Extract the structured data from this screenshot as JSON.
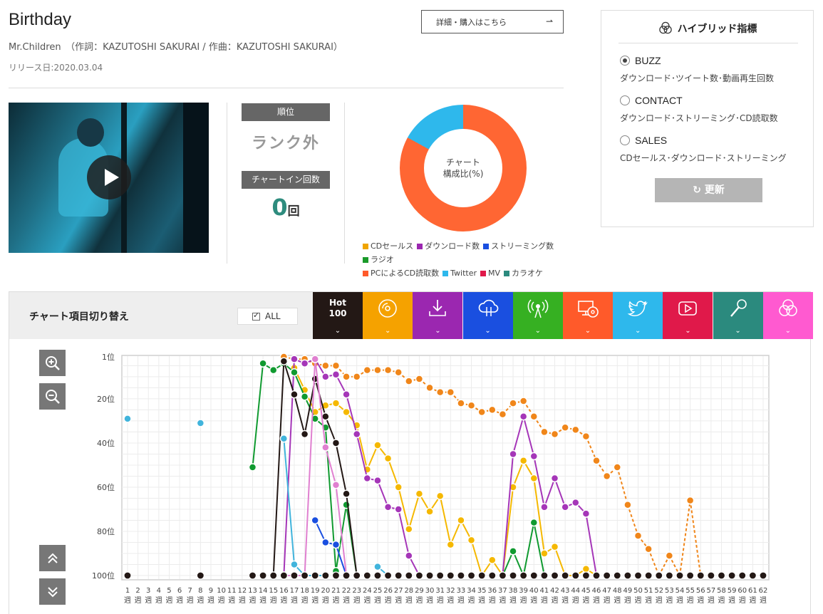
{
  "song": {
    "title": "Birthday",
    "credits": "Mr.Children　（作詞：KAZUTOSHI SAKURAI / 作曲：KAZUTOSHI SAKURAI）",
    "release": "リリース日:2020.03.04",
    "detail_button": "詳細・購入はこちら"
  },
  "rank": {
    "label": "順位",
    "value": "ランク外",
    "chartin_label": "チャートイン回数",
    "chartin_value": "0",
    "chartin_unit": "回"
  },
  "donut": {
    "center_line1": "チャート",
    "center_line2": "構成比(%)",
    "slices": [
      {
        "name": "PCによるCD読取数",
        "value": 83,
        "color": "#ff6633"
      },
      {
        "name": "Twitter",
        "value": 17,
        "color": "#2eb8ec"
      }
    ],
    "legend": [
      {
        "label": "CDセールス",
        "color": "#f0a500"
      },
      {
        "label": "ダウンロード数",
        "color": "#9b27b0"
      },
      {
        "label": "ストリーミング数",
        "color": "#1a4fe0"
      },
      {
        "label": "ラジオ",
        "color": "#1a9a2a"
      },
      {
        "label": "PCによるCD読取数",
        "color": "#ff5a2a"
      },
      {
        "label": "Twitter",
        "color": "#2eb8ec"
      },
      {
        "label": "MV",
        "color": "#e0194a"
      },
      {
        "label": "カラオケ",
        "color": "#2b8a7e"
      }
    ]
  },
  "hybrid": {
    "title": "ハイブリッド指標",
    "options": [
      {
        "name": "BUZZ",
        "desc": "ダウンロード･ツイート数･動画再生回数",
        "selected": true
      },
      {
        "name": "CONTACT",
        "desc": "ダウンロード･ストリーミング･CD読取数",
        "selected": false
      },
      {
        "name": "SALES",
        "desc": "CDセールス･ダウンロード･ストリーミング",
        "selected": false
      }
    ],
    "update_button": "更新"
  },
  "chart_section": {
    "label": "チャート項目切り替え",
    "all_label": "ALL",
    "tabs": [
      {
        "name": "hot100",
        "label_line1": "Hot",
        "label_line2": "100",
        "color": "#231815",
        "icon": "hot100"
      },
      {
        "name": "cd-sales",
        "color": "#f5a200",
        "icon": "cd-icon"
      },
      {
        "name": "download",
        "color": "#9b27b0",
        "icon": "download-icon"
      },
      {
        "name": "streaming",
        "color": "#1a4fe0",
        "icon": "streaming-icon"
      },
      {
        "name": "radio",
        "color": "#36b022",
        "icon": "radio-icon"
      },
      {
        "name": "pc-cd-read",
        "color": "#ff5a2a",
        "icon": "pc-cd-icon"
      },
      {
        "name": "twitter",
        "color": "#2eb8ec",
        "icon": "twitter-icon"
      },
      {
        "name": "mv",
        "color": "#e0194a",
        "icon": "youtube-icon"
      },
      {
        "name": "karaoke",
        "color": "#2b8a7e",
        "icon": "microphone-icon"
      },
      {
        "name": "hybrid",
        "color": "#ff5ad0",
        "icon": "hybrid-icon"
      }
    ]
  },
  "chart_data": {
    "type": "line",
    "y_inverted": true,
    "ylim": [
      1,
      100
    ],
    "y_tick_labels": [
      "1位",
      "20位",
      "40位",
      "60位",
      "80位",
      "100位"
    ],
    "y_ticks": [
      1,
      20,
      40,
      60,
      80,
      100
    ],
    "x": [
      1,
      2,
      3,
      4,
      5,
      6,
      7,
      8,
      9,
      10,
      11,
      12,
      13,
      14,
      15,
      16,
      17,
      18,
      19,
      20,
      21,
      22,
      23,
      24,
      25,
      26,
      27,
      28,
      29,
      30,
      31,
      32,
      33,
      34,
      35,
      36,
      37,
      38,
      39,
      40,
      41,
      42,
      43,
      44,
      45,
      46,
      47,
      48,
      49,
      50,
      51,
      52,
      53,
      54,
      55,
      56,
      57,
      58,
      59,
      60,
      61,
      62
    ],
    "x_tick_suffix": "週",
    "series": [
      {
        "key": "pc",
        "color": "#f0861a",
        "dashed": true,
        "points": [
          [
            16,
            1
          ],
          [
            17,
            2
          ],
          [
            18,
            2
          ],
          [
            19,
            4
          ],
          [
            20,
            5
          ],
          [
            21,
            5
          ],
          [
            22,
            10
          ],
          [
            23,
            10
          ],
          [
            24,
            7
          ],
          [
            25,
            7
          ],
          [
            26,
            7
          ],
          [
            27,
            8
          ],
          [
            28,
            12
          ],
          [
            29,
            11
          ],
          [
            30,
            15
          ],
          [
            31,
            17
          ],
          [
            32,
            17
          ],
          [
            33,
            22
          ],
          [
            34,
            23
          ],
          [
            35,
            26
          ],
          [
            36,
            25
          ],
          [
            37,
            27
          ],
          [
            38,
            22
          ],
          [
            39,
            21
          ],
          [
            40,
            28
          ],
          [
            41,
            35
          ],
          [
            42,
            36
          ],
          [
            43,
            33
          ],
          [
            44,
            34
          ],
          [
            45,
            37
          ],
          [
            46,
            48
          ],
          [
            47,
            55
          ],
          [
            48,
            51
          ],
          [
            49,
            68
          ],
          [
            50,
            82
          ],
          [
            51,
            88
          ],
          [
            52,
            100
          ],
          [
            53,
            91
          ],
          [
            54,
            100
          ],
          [
            55,
            66
          ],
          [
            56,
            100
          ]
        ]
      },
      {
        "key": "cd",
        "color": "#f5b800",
        "dashed": false,
        "points": [
          [
            17,
            6
          ],
          [
            18,
            16
          ],
          [
            19,
            26
          ],
          [
            20,
            23
          ],
          [
            21,
            22
          ],
          [
            22,
            26
          ],
          [
            23,
            32
          ],
          [
            24,
            52
          ],
          [
            25,
            41
          ],
          [
            26,
            47
          ],
          [
            27,
            60
          ],
          [
            28,
            79
          ],
          [
            29,
            63
          ],
          [
            30,
            71
          ],
          [
            31,
            64
          ],
          [
            32,
            86
          ],
          [
            33,
            75
          ],
          [
            34,
            84
          ],
          [
            35,
            100
          ],
          [
            36,
            93
          ],
          [
            37,
            100
          ],
          [
            38,
            60
          ],
          [
            39,
            48
          ],
          [
            40,
            56
          ],
          [
            41,
            90
          ],
          [
            42,
            87
          ],
          [
            43,
            100
          ],
          [
            44,
            100
          ],
          [
            45,
            97
          ],
          [
            46,
            100
          ]
        ]
      },
      {
        "key": "dl",
        "color": "#a536b8",
        "dashed": false,
        "points": [
          [
            16,
            100
          ],
          [
            17,
            2
          ],
          [
            18,
            4
          ],
          [
            19,
            2
          ],
          [
            20,
            10
          ],
          [
            21,
            9
          ],
          [
            22,
            18
          ],
          [
            23,
            36
          ],
          [
            24,
            56
          ],
          [
            25,
            57
          ],
          [
            26,
            69
          ],
          [
            27,
            70
          ],
          [
            28,
            91
          ],
          [
            29,
            100
          ],
          [
            37,
            100
          ],
          [
            38,
            45
          ],
          [
            39,
            28
          ],
          [
            40,
            46
          ],
          [
            41,
            69
          ],
          [
            42,
            56
          ],
          [
            43,
            69
          ],
          [
            44,
            67
          ],
          [
            45,
            72
          ],
          [
            46,
            100
          ]
        ]
      },
      {
        "key": "radio",
        "color": "#109a30",
        "dashed": false,
        "points": [
          [
            13,
            51
          ],
          [
            14,
            4
          ],
          [
            15,
            7
          ],
          [
            16,
            4
          ],
          [
            17,
            8
          ],
          [
            18,
            19
          ],
          [
            19,
            29
          ],
          [
            20,
            33
          ],
          [
            21,
            98
          ],
          [
            22,
            68
          ],
          [
            23,
            100
          ],
          [
            37,
            100
          ],
          [
            38,
            89
          ],
          [
            39,
            100
          ],
          [
            40,
            76
          ],
          [
            41,
            100
          ]
        ]
      },
      {
        "key": "hot100",
        "color": "#231815",
        "dashed": false,
        "points": [
          [
            15,
            100
          ],
          [
            16,
            3
          ],
          [
            17,
            18
          ],
          [
            18,
            36
          ],
          [
            19,
            11
          ],
          [
            20,
            28
          ],
          [
            21,
            40
          ],
          [
            22,
            63
          ],
          [
            23,
            100
          ]
        ]
      },
      {
        "key": "stream",
        "color": "#1a4fe0",
        "dashed": false,
        "points": [
          [
            19,
            75
          ],
          [
            20,
            85
          ],
          [
            21,
            86
          ],
          [
            22,
            100
          ]
        ]
      },
      {
        "key": "twitter",
        "color": "#41b4dc",
        "dashed": false,
        "points": [
          [
            1,
            29
          ],
          [
            8,
            31
          ],
          [
            16,
            38
          ],
          [
            17,
            95
          ],
          [
            18,
            100
          ],
          [
            19,
            100
          ],
          [
            20,
            100
          ],
          [
            25,
            96
          ],
          [
            26,
            100
          ]
        ]
      },
      {
        "key": "mv",
        "color": "#e080d0",
        "dashed": false,
        "points": [
          [
            16,
            100
          ],
          [
            17,
            100
          ],
          [
            18,
            100
          ],
          [
            19,
            2
          ],
          [
            20,
            42
          ],
          [
            21,
            59
          ],
          [
            22,
            100
          ]
        ]
      }
    ],
    "hot100_out": [
      1,
      8,
      13,
      14,
      15,
      16,
      17,
      18,
      19,
      20,
      21,
      22,
      23,
      24,
      25,
      26,
      27,
      28,
      29,
      30,
      31,
      32,
      33,
      34,
      35,
      36,
      37,
      38,
      39,
      40,
      41,
      42,
      43,
      44,
      45,
      46,
      47,
      48,
      49,
      50,
      51,
      52,
      53,
      54,
      55,
      56,
      57,
      58,
      59,
      60,
      61,
      62
    ]
  }
}
